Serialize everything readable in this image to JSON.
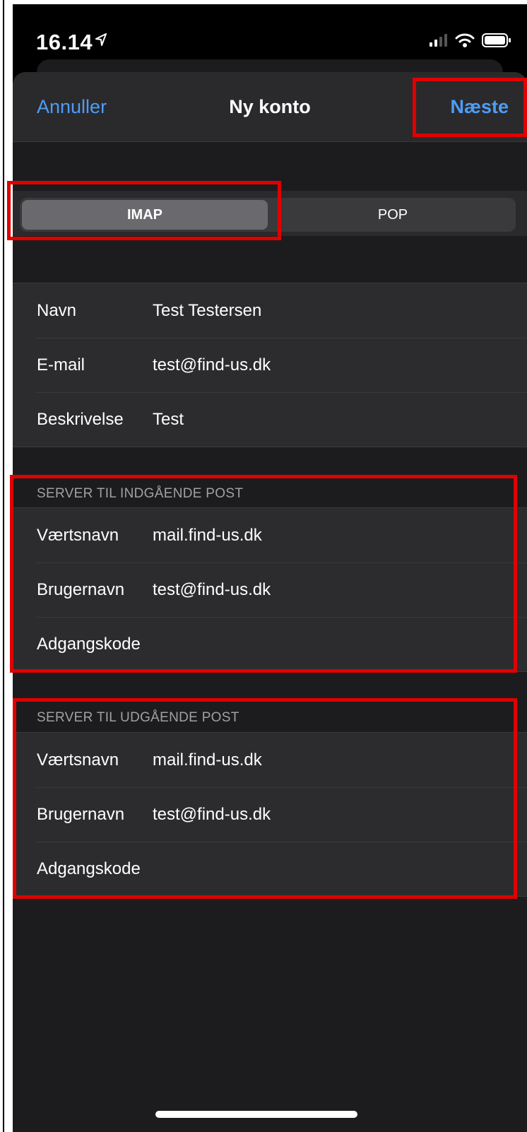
{
  "status_bar": {
    "time": "16.14"
  },
  "nav": {
    "cancel": "Annuller",
    "title": "Ny konto",
    "next": "Næste"
  },
  "segment": {
    "options": [
      "IMAP",
      "POP"
    ],
    "selected": "IMAP"
  },
  "account": [
    {
      "label": "Navn",
      "value": "Test Testersen"
    },
    {
      "label": "E-mail",
      "value": "test@find-us.dk"
    },
    {
      "label": "Beskrivelse",
      "value": "Test"
    }
  ],
  "incoming": {
    "header": "SERVER TIL INDGÅENDE POST",
    "rows": [
      {
        "label": "Værtsnavn",
        "value": "mail.find-us.dk"
      },
      {
        "label": "Brugernavn",
        "value": "test@find-us.dk"
      },
      {
        "label": "Adgangskode",
        "value": ""
      }
    ]
  },
  "outgoing": {
    "header": "SERVER TIL UDGÅENDE POST",
    "rows": [
      {
        "label": "Værtsnavn",
        "value": "mail.find-us.dk"
      },
      {
        "label": "Brugernavn",
        "value": "test@find-us.dk"
      },
      {
        "label": "Adgangskode",
        "value": ""
      }
    ]
  },
  "colors": {
    "accent": "#4e9cf5",
    "highlight": "#e00000",
    "background": "#1c1c1e"
  }
}
